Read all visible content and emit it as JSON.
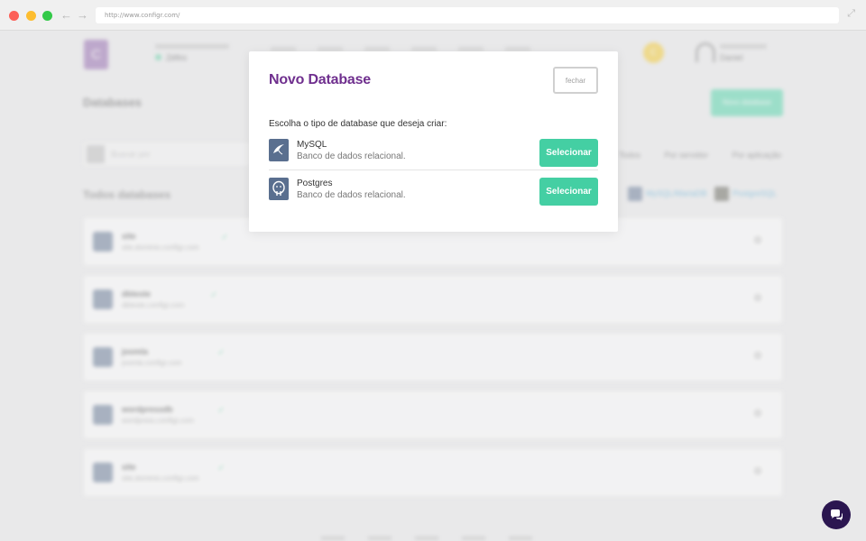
{
  "browser": {
    "url": "http://www.configr.com/"
  },
  "background": {
    "logo_letter": "C",
    "account_value": "Zéfiro",
    "coin": "C",
    "user_name": "Daniel",
    "page_title": "Databases",
    "new_button": "Novo database",
    "search_placeholder": "Buscar por",
    "filters": [
      "Todos",
      "Por servidor",
      "Por aplicação"
    ],
    "section_title": "Todos databases",
    "legend": [
      "MySQL/MariaDB",
      "PostgreSQL"
    ],
    "rows": [
      {
        "name": "site",
        "host": "site.dominio.configr.com"
      },
      {
        "name": "dbteste",
        "host": "dbteste.configr.com"
      },
      {
        "name": "joomla",
        "host": "joomla.configr.com"
      },
      {
        "name": "wordpressdb",
        "host": "wordpress.configr.com"
      },
      {
        "name": "site",
        "host": "site.dominio.configr.com"
      }
    ]
  },
  "modal": {
    "title": "Novo Database",
    "close_label": "fechar",
    "prompt": "Escolha o tipo de database que deseja criar:",
    "options": [
      {
        "name": "MySQL",
        "description": "Banco de dados relacional.",
        "button": "Selecionar",
        "icon": "dolphin-icon"
      },
      {
        "name": "Postgres",
        "description": "Banco de dados relacional.",
        "button": "Selecionar",
        "icon": "elephant-icon"
      }
    ]
  },
  "colors": {
    "modal_title": "#6f2f8e",
    "select_button": "#44cfa3",
    "chat_button": "#2b1650",
    "db_icon_bg": "#5a6f8f"
  }
}
